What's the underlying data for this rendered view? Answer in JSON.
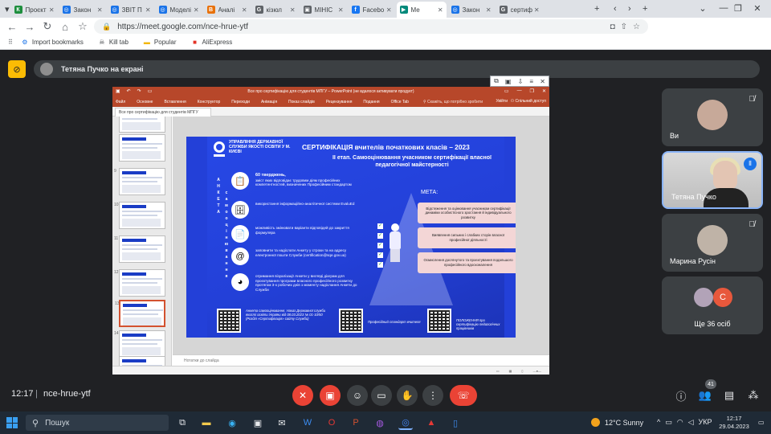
{
  "browser": {
    "tabs": [
      {
        "label": "Проєкт",
        "fav": "К",
        "color": "#1e8e3e"
      },
      {
        "label": "Закон",
        "fav": "◎",
        "color": "#1a73e8"
      },
      {
        "label": "ЗВІТ П",
        "fav": "◎",
        "color": "#1a73e8"
      },
      {
        "label": "Моделі",
        "fav": "◎",
        "color": "#1a73e8"
      },
      {
        "label": "Аналі",
        "fav": "B",
        "color": "#e8710a"
      },
      {
        "label": "кізюл",
        "fav": "G",
        "color": "#5f6368"
      },
      {
        "label": "МІНІС",
        "fav": "▣",
        "color": "#5f6368"
      },
      {
        "label": "Facebo",
        "fav": "f",
        "color": "#1877f2"
      },
      {
        "label": "Ме",
        "fav": "▶",
        "color": "#00897b"
      },
      {
        "label": "Закон",
        "fav": "◎",
        "color": "#1a73e8"
      },
      {
        "label": "сертиф",
        "fav": "G",
        "color": "#5f6368"
      }
    ],
    "active_tab": 8,
    "url": "https://meet.google.com/nce-hrue-ytf",
    "bookmarks": [
      "Import bookmarks",
      "Kill tab",
      "Popular",
      "AliExpress"
    ]
  },
  "meet": {
    "presenter_label": "Тетяна Пучко на екрані",
    "participants": [
      {
        "name": "Ви"
      },
      {
        "name": "Тетяна Пучко"
      },
      {
        "name": "Марина Русін"
      }
    ],
    "others_label": "Ще 36 осіб",
    "others_initial": "С",
    "time": "12:17",
    "separator": "|",
    "meeting_code": "nce-hrue-ytf",
    "people_count": "41"
  },
  "ppt": {
    "window_title": "Все про сертифікацію для студентів МПГУ – PowerPoint (не вдалося активувати продукт)",
    "ribbon_tabs": [
      "Файл",
      "Основне",
      "Вставлення",
      "Конструктор",
      "Переходи",
      "Анімація",
      "Показ слайдів",
      "Рецензування",
      "Подання",
      "Office Tab"
    ],
    "tell_me": "Скажіть, що потрібно зробити",
    "sign_in": "Увійти",
    "share": "Спільний доступ",
    "doc_tab": "Все про сертифікацію для студентів МПГУ",
    "notes": "Нотатки до слайда",
    "thumb_numbers": [
      "",
      "",
      "9",
      "10",
      "11",
      "12",
      "13",
      "14",
      ""
    ]
  },
  "slide": {
    "org": "УПРАВЛІННЯ ДЕРЖАВНОЇ СЛУЖБИ ЯКОСТІ ОСВІТИ У М. КИЄВІ",
    "title": "СЕРТИФІКАЦІЯ вчителів початкових класів – 2023",
    "subtitle": "ІІ етап. Самооцінювання учасником сертифікації власної педагогічної майстерності",
    "vertical1": "АНКЕТА",
    "vertical2": "самооцінювання",
    "items": [
      {
        "strong": "60 тверджень,",
        "text": "зміст яких відповідає трудовим діям професійних компетентностей, визначених Професійним стандартом"
      },
      {
        "strong": "",
        "text": "використання інформаційно-аналітичної системи EvaluEd"
      },
      {
        "strong": "",
        "text": "можливість змінювати варіанти відповідей до закриття формуляра"
      },
      {
        "strong": "",
        "text": "заповнити та надіслати Анкету у строки та на адресу електронної пошти Служби (certification@sqe.gov.ua)"
      },
      {
        "strong": "",
        "text": "отримання візуалізації Анкети у вигляді діаграм для проєктування програми власного професійного розвитку протягом 3-х робочих днів з моменту надіслання Анкети до Служби"
      }
    ],
    "meta": "МЕТА:",
    "goals": [
      "Відстеження та оцінювання учасником сертифікації динаміки особистісного зростання й індивідуального розвитку",
      "Виявлення сильних і слабких сторін власної професійної діяльності",
      "Осмислення досягнутого та проєктування подальшого професійного вдосконалення"
    ],
    "qr_texts": [
      "Анкета самооцінювання. Наказ Державної служби якості освіти України від 08.03.2023 № 01-10/50 (Розділ «Сертифікація» сайту Служби)",
      "Професійний стандарт вчителя",
      "ПОЛОЖЕННЯ про сертифікацію педагогічних працівників"
    ]
  },
  "taskbar": {
    "search_placeholder": "Пошук",
    "weather": "12°C  Sunny",
    "lang": "УКР",
    "time": "12:17",
    "date": "29.04.2023"
  },
  "colors": {
    "meet_bg": "#202124",
    "ppt_accent": "#b7472a",
    "slide_blue": "#2340d8",
    "end_call": "#ea4335"
  }
}
